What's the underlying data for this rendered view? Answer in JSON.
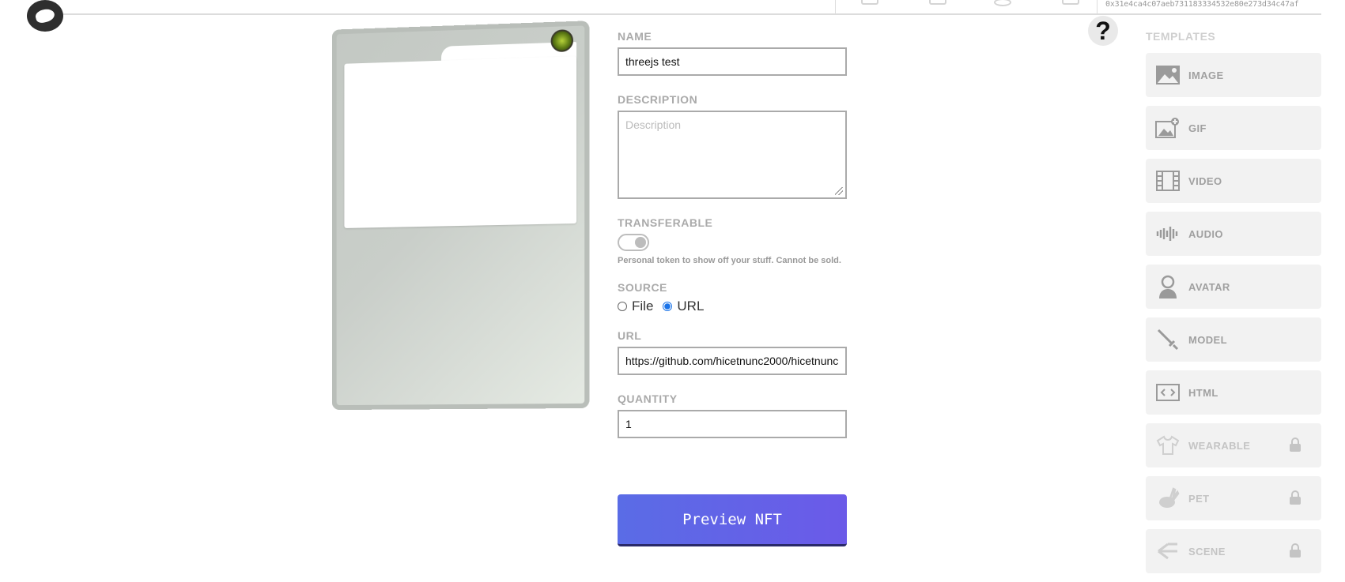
{
  "header": {
    "wallet_address": "0x31e4ca4c07aeb731183334532e80e273d34c47af",
    "help_label": "?"
  },
  "form": {
    "name_label": "NAME",
    "name_value": "threejs test",
    "description_label": "DESCRIPTION",
    "description_placeholder": "Description",
    "transferable_label": "TRANSFERABLE",
    "transferable_note": "Personal token to show off your stuff. Cannot be sold.",
    "source_label": "SOURCE",
    "source_options": [
      "File",
      "URL"
    ],
    "source_selected": "URL",
    "url_label": "URL",
    "url_value": "https://github.com/hicetnunc2000/hicetnunc",
    "quantity_label": "QUANTITY",
    "quantity_value": "1",
    "preview_button": "Preview NFT"
  },
  "templates": {
    "title": "TEMPLATES",
    "items": [
      {
        "label": "IMAGE",
        "icon": "image-icon",
        "locked": false
      },
      {
        "label": "GIF",
        "icon": "gif-icon",
        "locked": false
      },
      {
        "label": "VIDEO",
        "icon": "film-icon",
        "locked": false
      },
      {
        "label": "AUDIO",
        "icon": "audio-wave-icon",
        "locked": false
      },
      {
        "label": "AVATAR",
        "icon": "avatar-icon",
        "locked": false
      },
      {
        "label": "MODEL",
        "icon": "sword-icon",
        "locked": false
      },
      {
        "label": "HTML",
        "icon": "code-icon",
        "locked": false
      },
      {
        "label": "WEARABLE",
        "icon": "shirt-icon",
        "locked": true
      },
      {
        "label": "PET",
        "icon": "rabbit-icon",
        "locked": true
      },
      {
        "label": "SCENE",
        "icon": "scene-icon",
        "locked": true
      }
    ]
  }
}
